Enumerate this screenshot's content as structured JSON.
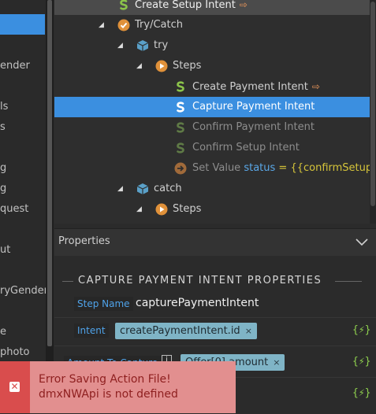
{
  "left_panel": {
    "fragments": [
      "ender",
      "ls",
      "s",
      "g",
      "g",
      "quest",
      "ut",
      "ryGender",
      "e",
      "photo"
    ]
  },
  "tree": {
    "rows": [
      {
        "label": "Create Setup Intent"
      },
      {
        "label": "Try/Catch"
      },
      {
        "label": "try"
      },
      {
        "label": "Steps"
      },
      {
        "label": "Create Payment Intent"
      },
      {
        "label": "Capture Payment Intent"
      },
      {
        "label": "Confirm Payment Intent"
      },
      {
        "label": "Confirm Setup Intent"
      },
      {
        "label": "Set Value",
        "key": "status",
        "expr": "= {{confirmSetupIntent"
      },
      {
        "label": "catch"
      },
      {
        "label": "Steps"
      }
    ]
  },
  "properties": {
    "header": "Properties",
    "section_title": "CAPTURE PAYMENT INTENT PROPERTIES",
    "step_name_label": "Step Name",
    "step_name_value": "capturePaymentIntent",
    "intent_label": "Intent",
    "intent_tag": "createPaymentIntent.id",
    "amount_label": "Amount To Capture",
    "amount_tag": "Offer[0].amount",
    "tag_remove": "×",
    "dynamic_icon": "{⚡}"
  },
  "toast": {
    "message": "Error Saving Action File! dmxNWApi is not defined",
    "icon": "close-icon"
  },
  "colors": {
    "selection": "#3b8fe0",
    "field_label": "#4fa3ea",
    "tag_bg": "#7fb4c6",
    "toast_bg": "#e28f8f",
    "toast_icon_bg": "#d94d4d"
  }
}
